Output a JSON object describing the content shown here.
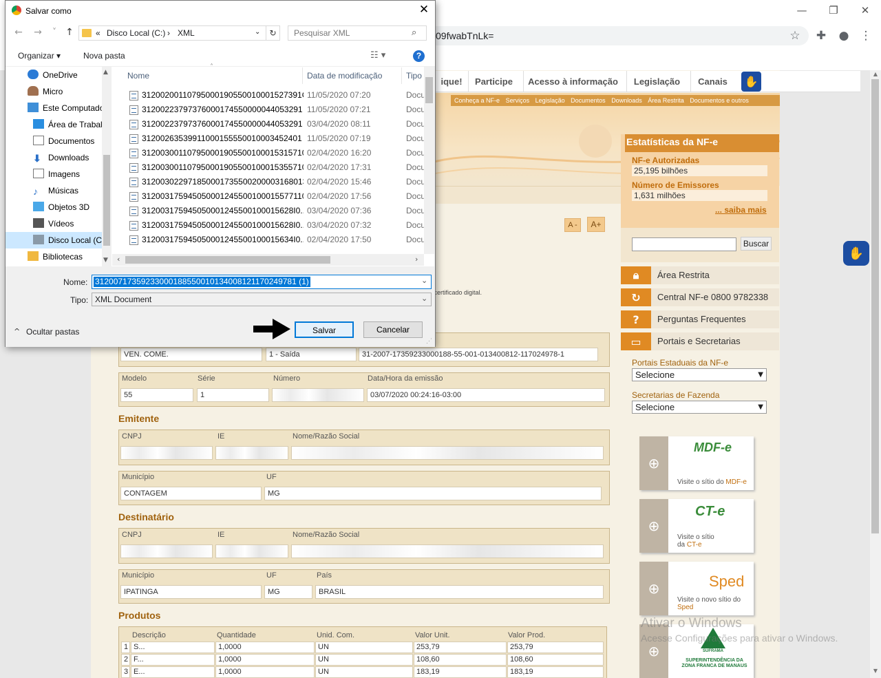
{
  "browser": {
    "url_fragment": "09fwabTnLk=",
    "window_controls": [
      "minimize",
      "restore",
      "close"
    ]
  },
  "site": {
    "nav": [
      "ique!",
      "Participe",
      "Acesso à informação",
      "Legislação",
      "Canais"
    ],
    "banner_links": [
      "Conheça a NF-e",
      "Serviços",
      "Legislação",
      "Documentos",
      "Downloads",
      "Área Restrita",
      "Documentos e outros"
    ],
    "stats": {
      "title": "Estatísticas da NF-e",
      "authorized_label": "NF-e Autorizadas",
      "authorized_value": "25,195 bilhões",
      "issuers_label": "Número de Emissores",
      "issuers_value": "1,631 milhões",
      "more": "... saiba mais"
    },
    "font_dec": "A -",
    "font_inc": "A+",
    "search_button": "Buscar",
    "menu": [
      "Área Restrita",
      "Central NF-e 0800 9782338",
      "Perguntas Frequentes",
      "Portais e Secretarias"
    ],
    "portais_label": "Portais Estaduais da NF-e",
    "portais_value": "Selecione",
    "secretarias_label": "Secretarias de Fazenda",
    "secretarias_value": "Selecione",
    "sites": [
      {
        "logo": "MDF-e",
        "text": "Visite o sítio do ",
        "link": "MDF-e"
      },
      {
        "logo": "CT-e",
        "text": "Visite o sítio da ",
        "link": "CT-e"
      },
      {
        "logo": "Sped",
        "text": "Visite o novo sítio do ",
        "link": "Sped"
      },
      {
        "logo": "SUFRAMA",
        "text": "SUPERINTENDÊNCIA DA ZONA FRANCA DE MANAUS",
        "link": ""
      }
    ],
    "watermark_title": "Ativar o Windows",
    "watermark_text": "Acesse Configurações para ativar o Windows.",
    "cert_text": "er certificado digital.",
    "nfe": {
      "operation": "VEN. COME.",
      "tipo": "1 - Saída",
      "chave": "31-2007-17359233000188-55-001-013400812-117024978-1",
      "modelo_label": "Modelo",
      "modelo": "55",
      "serie_label": "Série",
      "serie": "1",
      "numero_label": "Número",
      "emissao_label": "Data/Hora da emissão",
      "emissao": "03/07/2020 00:24:16-03:00",
      "emitente_title": "Emitente",
      "destinatario_title": "Destinatário",
      "produtos_title": "Produtos",
      "cnpj_label": "CNPJ",
      "ie_label": "IE",
      "nome_label": "Nome/Razão Social",
      "municipio_label": "Município",
      "uf_label": "UF",
      "pais_label": "País",
      "emit_municipio": "CONTAGEM",
      "emit_uf": "MG",
      "dest_municipio": "IPATINGA",
      "dest_uf": "MG",
      "dest_pais": "BRASIL",
      "prod_headers": [
        "Descrição",
        "Quantidade",
        "Unid. Com.",
        "Valor Unit.",
        "Valor Prod."
      ],
      "products": [
        {
          "n": "1",
          "desc": "S...",
          "qtd": "1,0000",
          "un": "UN",
          "vu": "253,79",
          "vp": "253,79"
        },
        {
          "n": "2",
          "desc": "F...",
          "qtd": "1,0000",
          "un": "UN",
          "vu": "108,60",
          "vp": "108,60"
        },
        {
          "n": "3",
          "desc": "E...",
          "qtd": "1,0000",
          "un": "UN",
          "vu": "183,19",
          "vp": "183,19"
        }
      ]
    }
  },
  "dialog": {
    "title": "Salvar como",
    "path": [
      "«",
      "Disco Local (C:)",
      "›",
      "XML"
    ],
    "search_placeholder": "Pesquisar XML",
    "organize": "Organizar ▾",
    "new_folder": "Nova pasta",
    "nav_items": [
      "OneDrive",
      "Micro",
      "Este Computador",
      "Área de Trabalho",
      "Documentos",
      "Downloads",
      "Imagens",
      "Músicas",
      "Objetos 3D",
      "Vídeos",
      "Disco Local (C:)",
      "Bibliotecas"
    ],
    "columns": [
      "Nome",
      "Data de modificação",
      "Tipo"
    ],
    "files": [
      {
        "name": "31200200110795000190550010001527391O...",
        "date": "11/05/2020 07:20",
        "type": "Docu"
      },
      {
        "name": "31200223797376000174550000044053291 3...",
        "date": "11/05/2020 07:21",
        "type": "Docu"
      },
      {
        "name": "31200223797376000174550000044053291 3...",
        "date": "03/04/2020 08:11",
        "type": "Docu"
      },
      {
        "name": "31200263539911000155550010003452401 1...",
        "date": "11/05/2020 07:19",
        "type": "Docu"
      },
      {
        "name": "312003001107950001905500100015315710...",
        "date": "02/04/2020 16:20",
        "type": "Docu"
      },
      {
        "name": "312003001107950001905500100015355710...",
        "date": "02/04/2020 17:31",
        "type": "Docu"
      },
      {
        "name": "312003022971850001735500200003168013...",
        "date": "02/04/2020 15:46",
        "type": "Docu"
      },
      {
        "name": "312003175945050001245500100015577110...",
        "date": "02/04/2020 17:56",
        "type": "Docu"
      },
      {
        "name": "312003175945050001245500100015628I0...",
        "date": "03/04/2020 07:36",
        "type": "Docu"
      },
      {
        "name": "312003175945050001245500100015628I0...",
        "date": "03/04/2020 07:32",
        "type": "Docu"
      },
      {
        "name": "312003175945050001245500100015634I0...",
        "date": "02/04/2020 17:50",
        "type": "Docu"
      }
    ],
    "name_label": "Nome:",
    "name_value": "31200717359233000188550010134008121170249781 (1)",
    "type_label": "Tipo:",
    "type_value": "XML Document",
    "hide_folders": "Ocultar pastas",
    "save": "Salvar",
    "cancel": "Cancelar"
  }
}
